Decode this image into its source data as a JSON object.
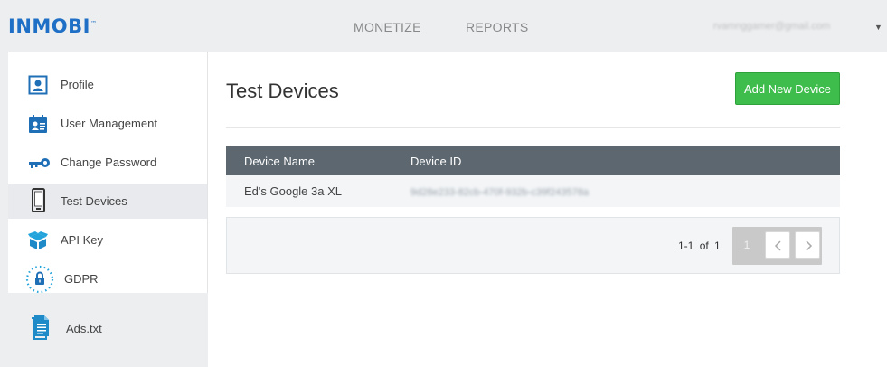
{
  "header": {
    "logo_text": "INMOBI",
    "nav": {
      "monetize": "MONETIZE",
      "reports": "REPORTS"
    },
    "account_email": "rvamnggamer@gmail.com",
    "brand_color": "#1e6fc5"
  },
  "sidebar": {
    "items": [
      {
        "label": "Profile",
        "icon": "profile-icon"
      },
      {
        "label": "User Management",
        "icon": "user-management-icon"
      },
      {
        "label": "Change Password",
        "icon": "key-icon"
      },
      {
        "label": "Test Devices",
        "icon": "phone-icon",
        "active": true
      },
      {
        "label": "API Key",
        "icon": "box-icon"
      },
      {
        "label": "GDPR",
        "icon": "lock-icon"
      }
    ],
    "ads_txt": {
      "label": "Ads.txt",
      "icon": "document-icon"
    }
  },
  "main": {
    "title": "Test Devices",
    "add_button": "Add New Device",
    "accent_color": "#3fbd4c",
    "table": {
      "columns": [
        "Device Name",
        "Device ID"
      ],
      "rows": [
        {
          "name": "Ed's Google 3a XL",
          "device_id": "9d28e233-82cb-470f-932b-c39f243578a"
        }
      ],
      "header_color": "#5c6770"
    },
    "pagination": {
      "range": "1-1",
      "of_label": "of",
      "total": "1",
      "current_page": "1"
    }
  }
}
